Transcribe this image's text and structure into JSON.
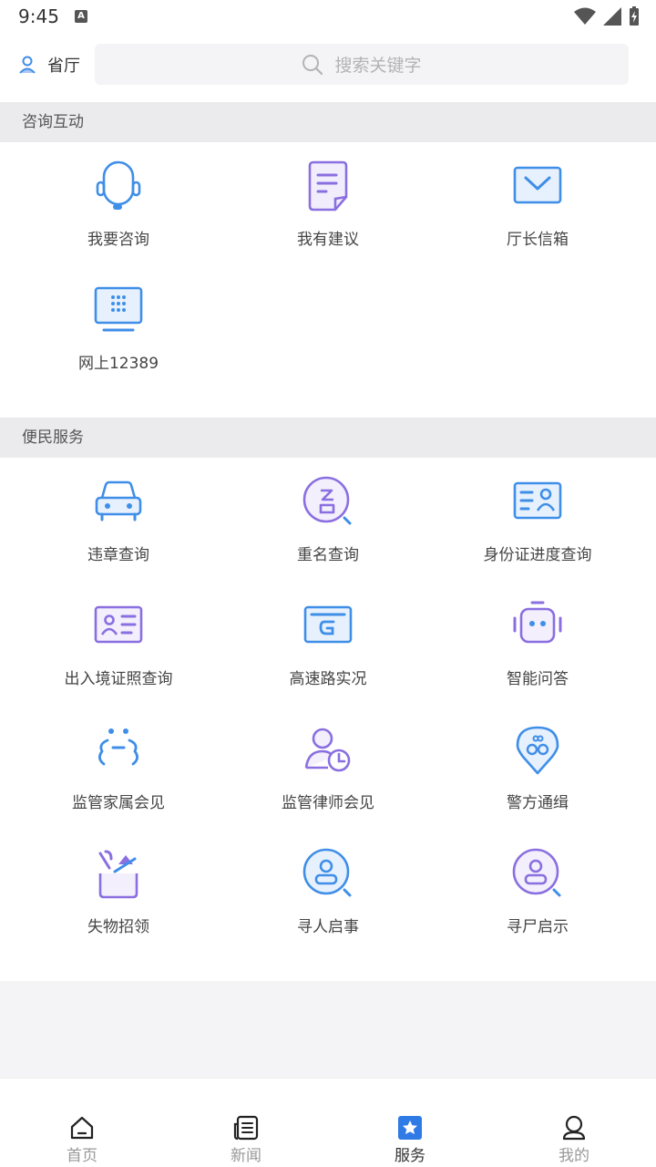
{
  "status": {
    "time": "9:45",
    "indicator": "A"
  },
  "header": {
    "location_label": "省厅",
    "search_placeholder": "搜索关键字",
    "icons": {
      "location": "location-person-icon",
      "search": "search-icon"
    }
  },
  "sections": [
    {
      "title": "咨询互动",
      "items": [
        {
          "label": "我要咨询",
          "icon": "headset-icon"
        },
        {
          "label": "我有建议",
          "icon": "document-icon"
        },
        {
          "label": "厅长信箱",
          "icon": "mail-icon"
        },
        {
          "label": "网上12389",
          "icon": "dialpad-monitor-icon"
        }
      ]
    },
    {
      "title": "便民服务",
      "items": [
        {
          "label": "违章查询",
          "icon": "car-icon"
        },
        {
          "label": "重名查询",
          "icon": "name-search-icon"
        },
        {
          "label": "身份证进度查询",
          "icon": "id-card-icon"
        },
        {
          "label": "出入境证照查询",
          "icon": "passport-card-icon"
        },
        {
          "label": "高速路实况",
          "icon": "highway-monitor-icon"
        },
        {
          "label": "智能问答",
          "icon": "robot-icon"
        },
        {
          "label": "监管家属会见",
          "icon": "family-visit-icon"
        },
        {
          "label": "监管律师会见",
          "icon": "lawyer-clock-icon"
        },
        {
          "label": "警方通缉",
          "icon": "handcuffs-pin-icon"
        },
        {
          "label": "失物招领",
          "icon": "lost-found-box-icon"
        },
        {
          "label": "寻人启事",
          "icon": "person-search-icon"
        },
        {
          "label": "寻尸启示",
          "icon": "person-search-alt-icon"
        }
      ]
    }
  ],
  "bottom_nav": [
    {
      "label": "首页",
      "icon": "home-icon",
      "active": false
    },
    {
      "label": "新闻",
      "icon": "news-icon",
      "active": false
    },
    {
      "label": "服务",
      "icon": "service-star-icon",
      "active": true
    },
    {
      "label": "我的",
      "icon": "profile-icon",
      "active": false
    }
  ],
  "colors": {
    "primary_blue": "#3f8ee8",
    "accent_purple": "#8a6fe0",
    "active_nav": "#2f7ae5"
  }
}
